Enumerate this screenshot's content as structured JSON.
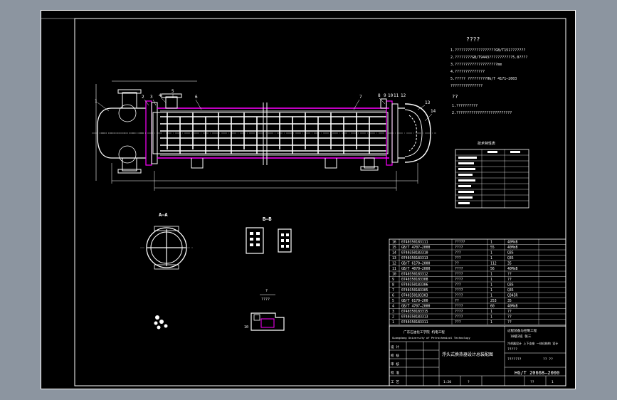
{
  "tech_req": {
    "title": "????",
    "items": [
      "1.???????????????????GB/T151???????",
      "2.????????GB/T9443???????????5.0????",
      "3.????????????????????mm",
      "4.??????????????",
      "5.????? ?????????HG/T 4171—2003",
      "???????????????"
    ]
  },
  "notes": {
    "title": "??",
    "items": [
      "1.??????????",
      "2.??????????????????????????"
    ]
  },
  "part_labels": [
    "1",
    "2",
    "3",
    "4",
    "5",
    "6",
    "7",
    "8",
    "9",
    "10",
    "11",
    "12",
    "13",
    "14"
  ],
  "section_aa": "A—A",
  "section_bb": "B—B",
  "detail_label": "?",
  "detail_scale": "????",
  "detail_tag": "10",
  "tech_char_title": "技术特性表",
  "bom_rows": [
    {
      "no": "16",
      "code": "0740350183111",
      "name": "?????",
      "qty": "1",
      "material": "40MnB"
    },
    {
      "no": "15",
      "code": "GB/T 4707—2000",
      "name": "????",
      "qty": "55",
      "material": "40MnB"
    },
    {
      "no": "14",
      "code": "0740350183310",
      "name": "???",
      "qty": "1",
      "material": "Q35"
    },
    {
      "no": "13",
      "code": "0740350183313",
      "name": "???",
      "qty": "1",
      "material": "Q35"
    },
    {
      "no": "12",
      "code": "GB/T 6170—2000",
      "name": "??",
      "qty": "112",
      "material": "35"
    },
    {
      "no": "11",
      "code": "GB/T 4070—2000",
      "name": "????",
      "qty": "56",
      "material": "40MnB"
    },
    {
      "no": "10",
      "code": "0740350183312",
      "name": "????",
      "qty": "1",
      "material": "??"
    },
    {
      "no": "9",
      "code": "0740350183308",
      "name": "????",
      "qty": "1",
      "material": "??"
    },
    {
      "no": "8",
      "code": "0740350183306",
      "name": "???",
      "qty": "1",
      "material": "Q35"
    },
    {
      "no": "7",
      "code": "0740350183305",
      "name": "????",
      "qty": "1",
      "material": "Q35"
    },
    {
      "no": "6",
      "code": "0740350183303",
      "name": "????",
      "qty": "1",
      "material": "Q345R"
    },
    {
      "no": "5",
      "code": "GB/T 6170—200",
      "name": "??",
      "qty": "253",
      "material": "35"
    },
    {
      "no": "4",
      "code": "GB/T 4707—2000",
      "name": "????",
      "qty": "60",
      "material": "40MnB"
    },
    {
      "no": "3",
      "code": "0740350183315",
      "name": "????",
      "qty": "1",
      "material": "??"
    },
    {
      "no": "2",
      "code": "0740350183313",
      "name": "????",
      "qty": "1",
      "material": "??"
    },
    {
      "no": "1",
      "code": "0740350183311",
      "name": "???",
      "qty": "1",
      "material": "??"
    }
  ],
  "title_block": {
    "header_left": "?? ?? ?? ?? ??",
    "header_left2": "??   ??   ??",
    "school": "广东石油化工学院  机电工程",
    "school_en": "Guangdong University of Petrochemical Technology",
    "owner1": "过程装备与控制工程",
    "owner2": "10级2班 张三",
    "owner3": "冷却器设计 上下支座 一体化结构 设计",
    "owner4": "?????",
    "owner5": "???????",
    "owner6": "?? ??",
    "drawing_name": "浮头式换热器设计总装配图",
    "drawing_no": "HG/T 20668—2000",
    "sign_labels": [
      "设 计",
      "校 核",
      "审 核",
      "批 准",
      "工 艺"
    ],
    "scale_row": [
      "1:20",
      "?",
      "??",
      "1"
    ]
  }
}
